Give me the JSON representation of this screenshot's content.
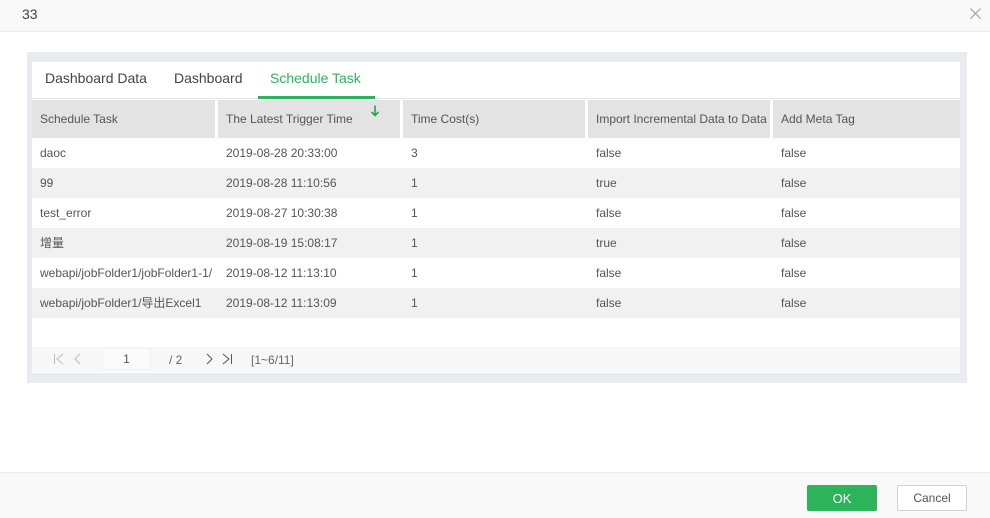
{
  "dialog": {
    "title": "33",
    "close_icon": "close-icon"
  },
  "tabs": [
    {
      "label": "Dashboard Data",
      "active": false
    },
    {
      "label": "Dashboard",
      "active": false
    },
    {
      "label": "Schedule Task",
      "active": true
    }
  ],
  "accent_color": "#2db45b",
  "table": {
    "columns": [
      {
        "label": "Schedule Task"
      },
      {
        "label": "The Latest Trigger Time",
        "sort": "descending",
        "sort_icon": "arrow-down-icon"
      },
      {
        "label": "Time Cost(s)"
      },
      {
        "label": "Import Incremental Data to Data"
      },
      {
        "label": "Add Meta Tag"
      }
    ],
    "rows": [
      [
        "daoc",
        "2019-08-28 20:33:00",
        "3",
        "false",
        "false"
      ],
      [
        "99",
        "2019-08-28 11:10:56",
        "1",
        "true",
        "false"
      ],
      [
        "test_error",
        "2019-08-27 10:30:38",
        "1",
        "false",
        "false"
      ],
      [
        "增量",
        "2019-08-19 15:08:17",
        "1",
        "true",
        "false"
      ],
      [
        "webapi/jobFolder1/jobFolder1-1/",
        "2019-08-12 11:13:10",
        "1",
        "false",
        "false"
      ],
      [
        "webapi/jobFolder1/导出Excel1",
        "2019-08-12 11:13:09",
        "1",
        "false",
        "false"
      ]
    ]
  },
  "pager": {
    "current_page": "1",
    "total_pages": "/ 2",
    "range": "[1~6/11]"
  },
  "footer": {
    "ok_label": "OK",
    "cancel_label": "Cancel"
  }
}
